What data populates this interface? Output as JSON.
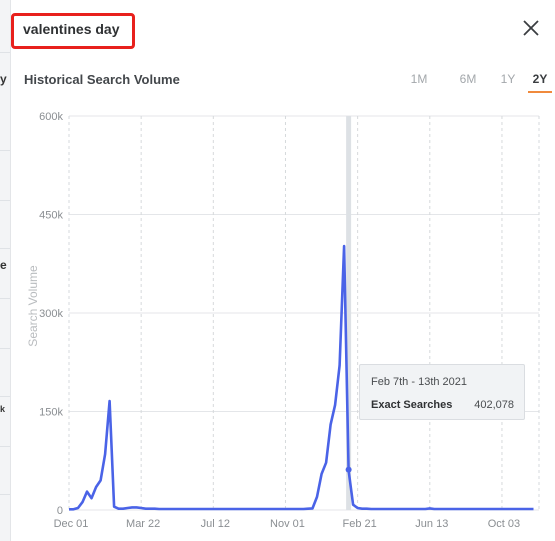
{
  "keyword": "valentines day",
  "section_title": "Historical Search Volume",
  "left_fragments": [
    "y",
    "e",
    "k"
  ],
  "range_tabs": [
    {
      "label": "1M",
      "active": false
    },
    {
      "label": "6M",
      "active": false
    },
    {
      "label": "1Y",
      "active": false
    },
    {
      "label": "2Y",
      "active": true
    }
  ],
  "close_icon": "close-icon",
  "colors": {
    "line": "#4a63e7",
    "accent": "#f08a3c",
    "highlight_box": "#e8201c"
  },
  "tooltip": {
    "date": "Feb 7th - 13th 2021",
    "label": "Exact Searches",
    "value": "402,078"
  },
  "chart_data": {
    "type": "line",
    "title": "Historical Search Volume",
    "xlabel": "",
    "ylabel": "Search Volume",
    "ylim": [
      0,
      600000
    ],
    "yticks": [
      0,
      150000,
      300000,
      450000,
      600000
    ],
    "ytick_labels": [
      "0",
      "150k",
      "300k",
      "450k",
      "600k"
    ],
    "xtick_labels": [
      "Dec 01",
      "Mar 22",
      "Jul 12",
      "Nov 01",
      "Feb 21",
      "Jun 13",
      "Oct 03"
    ],
    "xtick_week_index": [
      0,
      16,
      32,
      48,
      64,
      80,
      96
    ],
    "x_unit": "week index from Dec 01 2019",
    "grid": true,
    "highlight_week_index": 62,
    "series": [
      {
        "name": "Exact Searches",
        "values": [
          1000,
          1000,
          3000,
          12000,
          28000,
          18000,
          35000,
          45000,
          85000,
          166000,
          5000,
          2000,
          2000,
          3000,
          4000,
          4000,
          3000,
          2000,
          2000,
          2000,
          1500,
          1500,
          1500,
          1500,
          1500,
          1500,
          1500,
          1500,
          1500,
          1500,
          1500,
          1500,
          1500,
          1500,
          1500,
          1500,
          1500,
          1500,
          1500,
          1500,
          1500,
          1500,
          1500,
          1500,
          1500,
          1500,
          1500,
          1500,
          1500,
          1500,
          1500,
          1500,
          1500,
          2000,
          2500,
          20000,
          55000,
          72000,
          130000,
          160000,
          220000,
          402078,
          60000,
          8000,
          3000,
          2000,
          2000,
          1500,
          1500,
          1500,
          1500,
          1500,
          1500,
          1500,
          1500,
          1500,
          1500,
          1500,
          1500,
          1500,
          2500,
          1500,
          1500,
          1500,
          1500,
          1500,
          1500,
          1500,
          1500,
          1500,
          1500,
          1500,
          1500,
          1500,
          1500,
          1500,
          1500,
          1500,
          1500,
          1500,
          1500,
          1500,
          1500,
          1500
        ]
      }
    ]
  }
}
